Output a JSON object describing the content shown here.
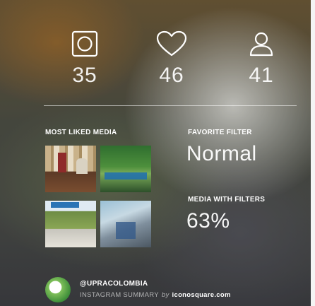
{
  "stats": [
    {
      "icon": "photo-icon",
      "value": "35"
    },
    {
      "icon": "heart-icon",
      "value": "46"
    },
    {
      "icon": "user-icon",
      "value": "41"
    }
  ],
  "most_liked": {
    "label": "MOST LIKED MEDIA",
    "thumbnails": [
      "media-thumbnail-1",
      "media-thumbnail-2",
      "media-thumbnail-3",
      "media-thumbnail-4"
    ]
  },
  "favorite_filter": {
    "label": "FAVORITE FILTER",
    "value": "Normal"
  },
  "media_with_filters": {
    "label": "MEDIA WITH FILTERS",
    "value": "63%"
  },
  "footer": {
    "username": "@UPRACOLOMBIA",
    "summary_label": "INSTAGRAM SUMMARY",
    "by_text": "by",
    "brand": "iconosquare.com"
  }
}
